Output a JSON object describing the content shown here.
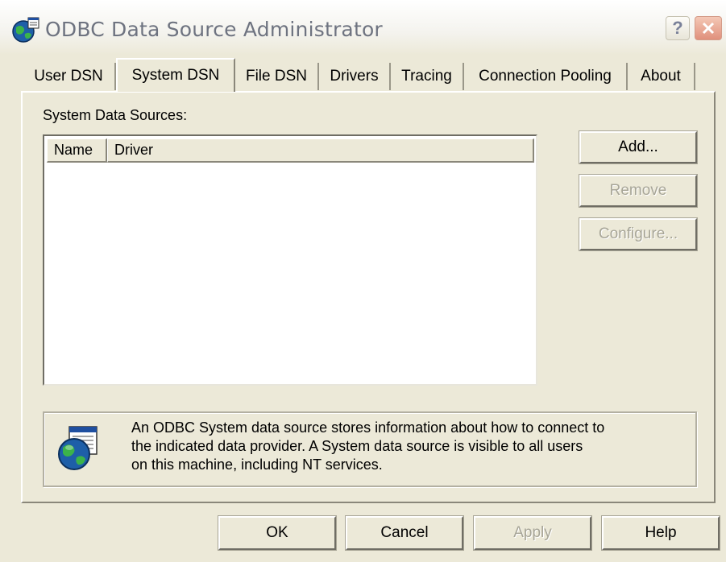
{
  "window": {
    "title": "ODBC Data Source Administrator",
    "help_glyph": "?",
    "close_glyph": "✕"
  },
  "tabs": [
    {
      "label": "User DSN",
      "active": false
    },
    {
      "label": "System DSN",
      "active": true
    },
    {
      "label": "File DSN",
      "active": false
    },
    {
      "label": "Drivers",
      "active": false
    },
    {
      "label": "Tracing",
      "active": false
    },
    {
      "label": "Connection Pooling",
      "active": false
    },
    {
      "label": "About",
      "active": false
    }
  ],
  "system_dsn": {
    "sources_label": "System Data Sources:",
    "columns": [
      "Name",
      "Driver"
    ],
    "rows": [],
    "buttons": {
      "add": "Add...",
      "remove": "Remove",
      "configure": "Configure..."
    },
    "info": {
      "lines": [
        "An ODBC System data source stores information about how to connect to",
        "the indicated data provider.   A System data source is visible to all users",
        "on this machine, including NT services."
      ]
    }
  },
  "dialog_buttons": {
    "ok": "OK",
    "cancel": "Cancel",
    "apply": "Apply",
    "help": "Help"
  },
  "icons": {
    "title": "odbc-globe-icon",
    "info": "database-globe-icon"
  },
  "colors": {
    "face": "#ece9d8",
    "disabled_text": "#a7a597",
    "close_button": "#e0907c"
  }
}
